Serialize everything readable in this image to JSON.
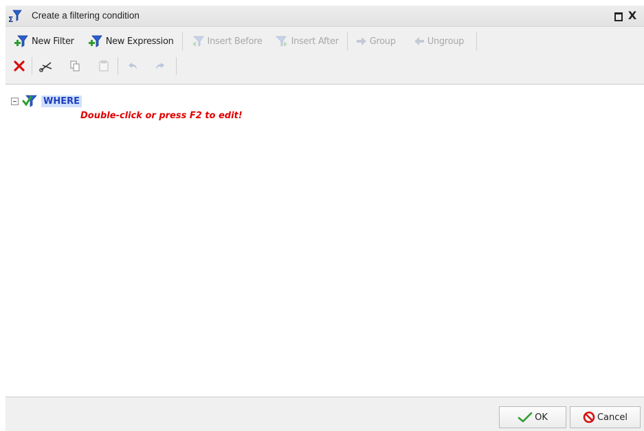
{
  "window": {
    "title": "Create a filtering condition",
    "maximize_icon": "maximize-icon",
    "close_label": "X"
  },
  "toolbar": {
    "new_filter": "New Filter",
    "new_expression": "New Expression",
    "insert_before": "Insert Before",
    "insert_after": "Insert After",
    "group": "Group",
    "ungroup": "Ungroup"
  },
  "edit_toolbar": {
    "icons": [
      "delete-icon",
      "cut-icon",
      "copy-icon",
      "paste-icon",
      "undo-icon",
      "redo-icon"
    ]
  },
  "tree": {
    "root_label": "WHERE",
    "hint": "Double-click or press F2 to edit!"
  },
  "footer": {
    "ok_label": "OK",
    "cancel_label": "Cancel"
  },
  "colors": {
    "accent": "#1f3fbf",
    "hint": "#e00000",
    "selection": "#cfe0fb",
    "disabled": "#a8a8a8"
  }
}
